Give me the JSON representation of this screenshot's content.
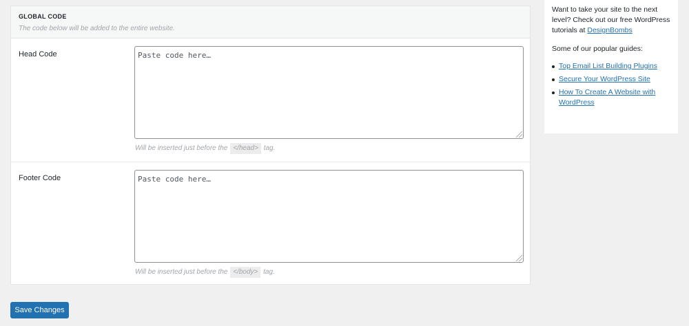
{
  "global_code": {
    "title": "GLOBAL CODE",
    "subtitle": "The code below will be added to the entire website."
  },
  "head_code": {
    "label": "Head Code",
    "placeholder": "Paste code here…",
    "hint_prefix": "Will be inserted just before the",
    "hint_tag": "</head>",
    "hint_suffix": "tag."
  },
  "footer_code": {
    "label": "Footer Code",
    "placeholder": "Paste code here…",
    "hint_prefix": "Will be inserted just before the",
    "hint_tag": "</body>",
    "hint_suffix": "tag."
  },
  "actions": {
    "save_label": "Save Changes"
  },
  "sidebar": {
    "intro_text": "Want to take your site to the next level? Check out our free WordPress tutorials at",
    "intro_link": "DesignBombs",
    "popular_heading": "Some of our popular guides:",
    "guides": [
      {
        "label": "Top Email List Building Plugins"
      },
      {
        "label": "Secure Your WordPress Site"
      },
      {
        "label": "How To Create A Website with WordPress"
      }
    ]
  },
  "colors": {
    "accent": "#2271b1",
    "background": "#f0f0f1"
  }
}
